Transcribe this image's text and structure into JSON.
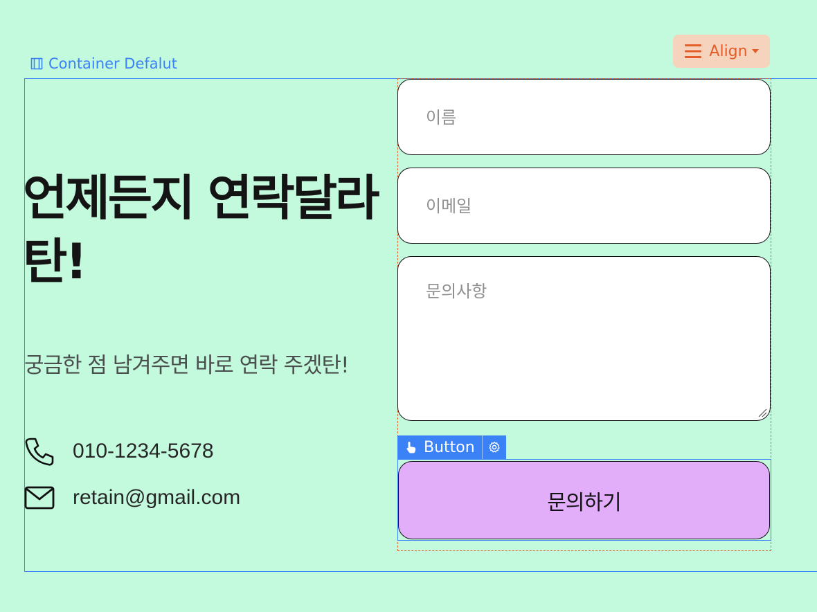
{
  "editor": {
    "container_label": "Container Defalut",
    "align_label": "Align",
    "button_tag_label": "Button"
  },
  "hero": {
    "headline": "언제든지 연락달라탄!",
    "subtitle": "궁금한 점 남겨주면 바로 연락 주겠탄!"
  },
  "contact": {
    "phone": "010-1234-5678",
    "email": "retain@gmail.com"
  },
  "form": {
    "name_placeholder": "이름",
    "email_placeholder": "이메일",
    "message_placeholder": "문의사항",
    "submit_label": "문의하기"
  },
  "colors": {
    "background": "#c3f9dc",
    "editor_accent": "#3b82f6",
    "align_accent": "#e35d2a",
    "submit_bg": "#e2aefa"
  },
  "icons": {
    "container": "layout-panel-icon",
    "align": "menu-lines-icon",
    "phone": "phone-icon",
    "email": "mail-icon",
    "button_tag": "pointer-hand-icon",
    "settings": "gear-icon"
  }
}
